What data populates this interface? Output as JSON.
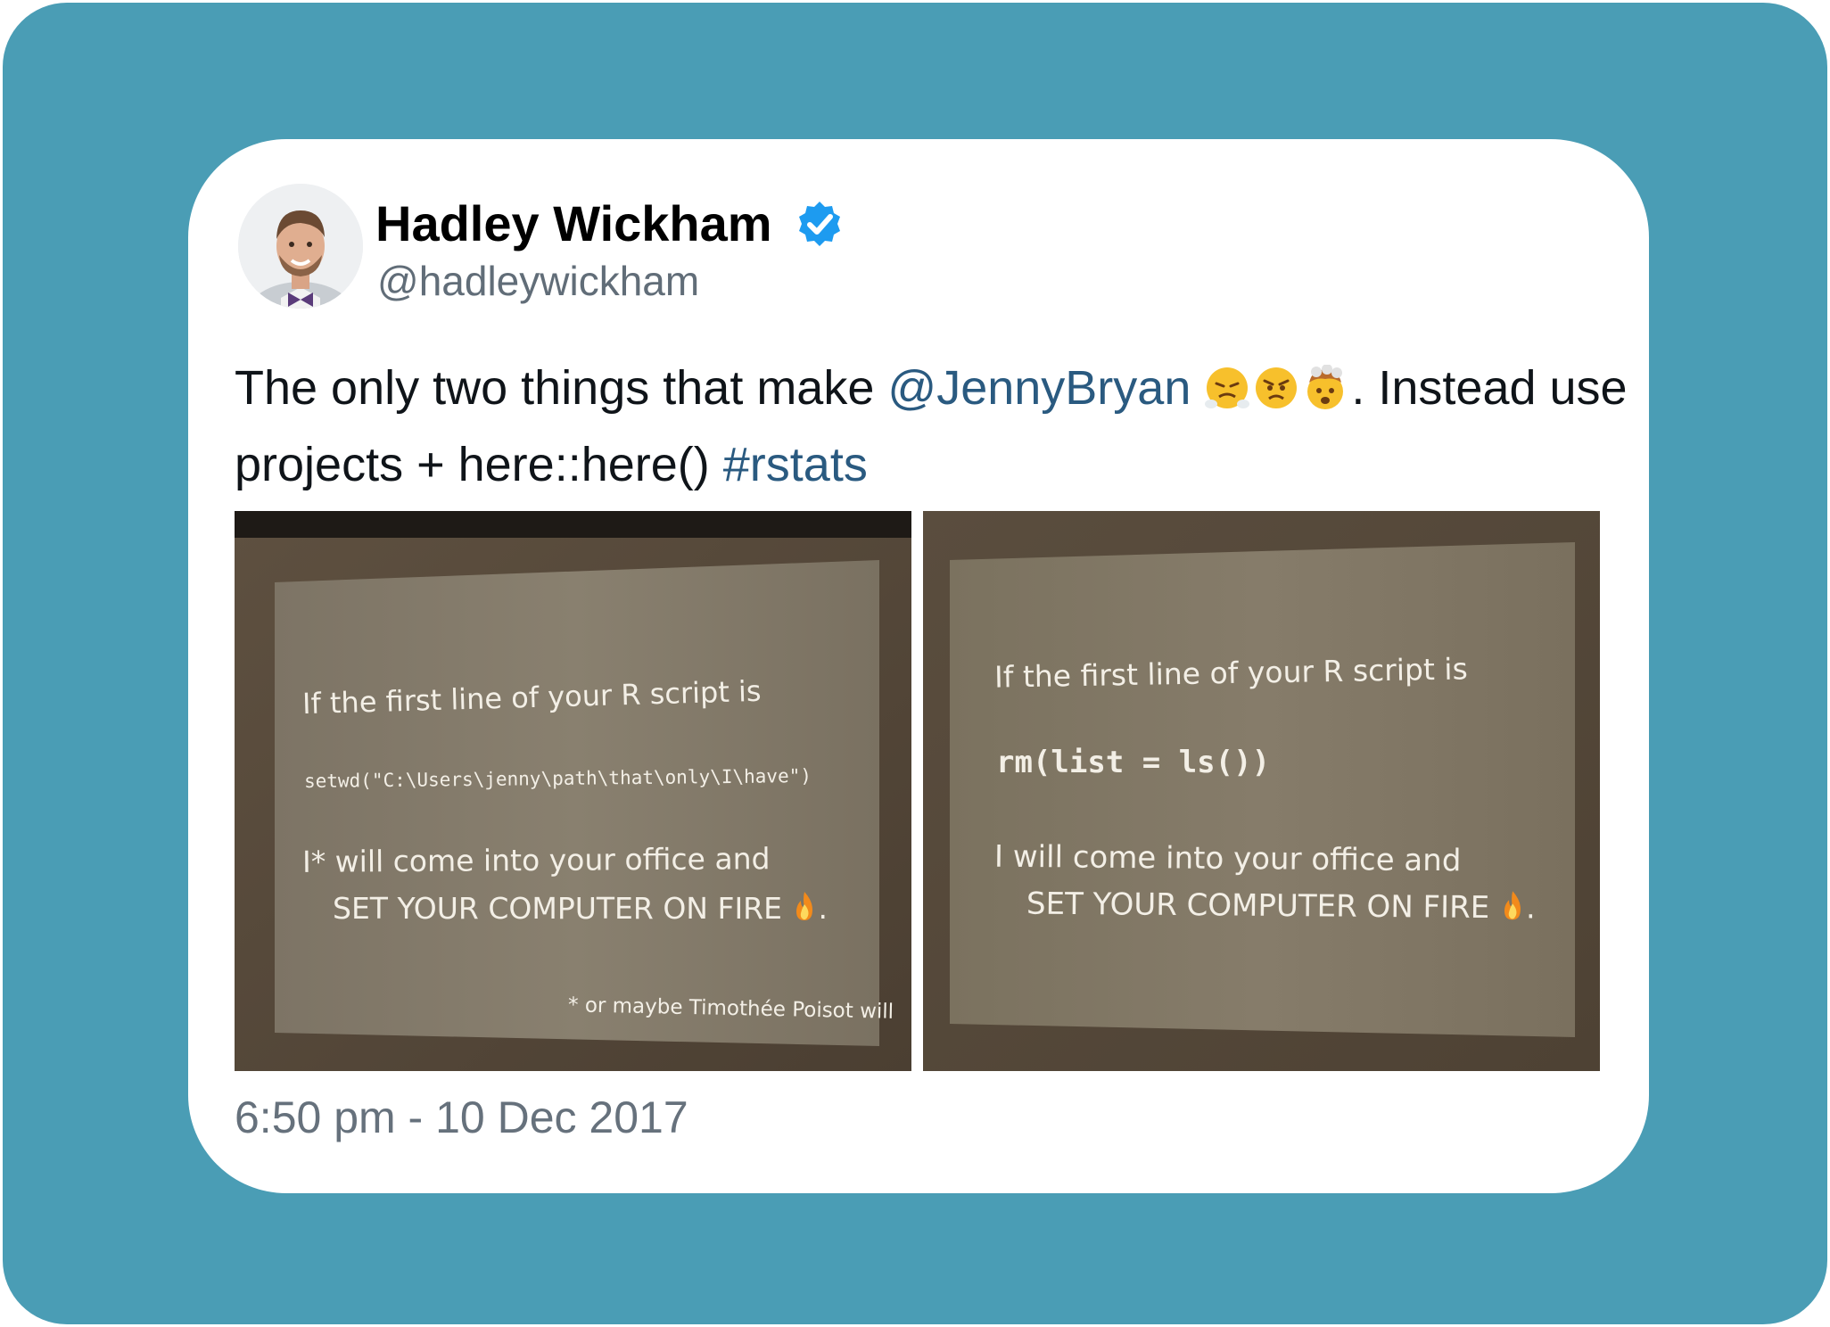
{
  "colors": {
    "frame": "#4a9db5",
    "card": "#ffffff",
    "link": "#2a5a80",
    "verified": "#1d9bf0",
    "muted": "#66717c"
  },
  "author": {
    "name": "Hadley Wickham",
    "handle": "@hadleywickham",
    "avatar_icon": "avatar-photo",
    "verified_icon": "verified-badge-icon"
  },
  "tweet": {
    "text_part1": "The only two things that make ",
    "mention": "@JennyBryan",
    "emoji": [
      "face-with-steam-from-nose",
      "angry-face",
      "exploding-head"
    ],
    "text_part2": ". Instead use projects + here::here() ",
    "hashtag": "#rstats"
  },
  "photos": [
    {
      "line1": "If the first line of your R script is",
      "code": "setwd(\"C:\\Users\\jenny\\path\\that\\only\\I\\have\")",
      "line3": "I* will come into your office and",
      "line4": "SET YOUR COMPUTER ON FIRE",
      "line4_end": ".",
      "footnote": "* or maybe Timothée Poisot will",
      "fire_icon": "fire-emoji"
    },
    {
      "line1": "If the first line of your R script is",
      "code": "rm(list = ls())",
      "line3": "I will come into your office and",
      "line4": "SET YOUR COMPUTER ON FIRE",
      "line4_end": ".",
      "fire_icon": "fire-emoji"
    }
  ],
  "timestamp": "6:50 pm - 10 Dec 2017"
}
